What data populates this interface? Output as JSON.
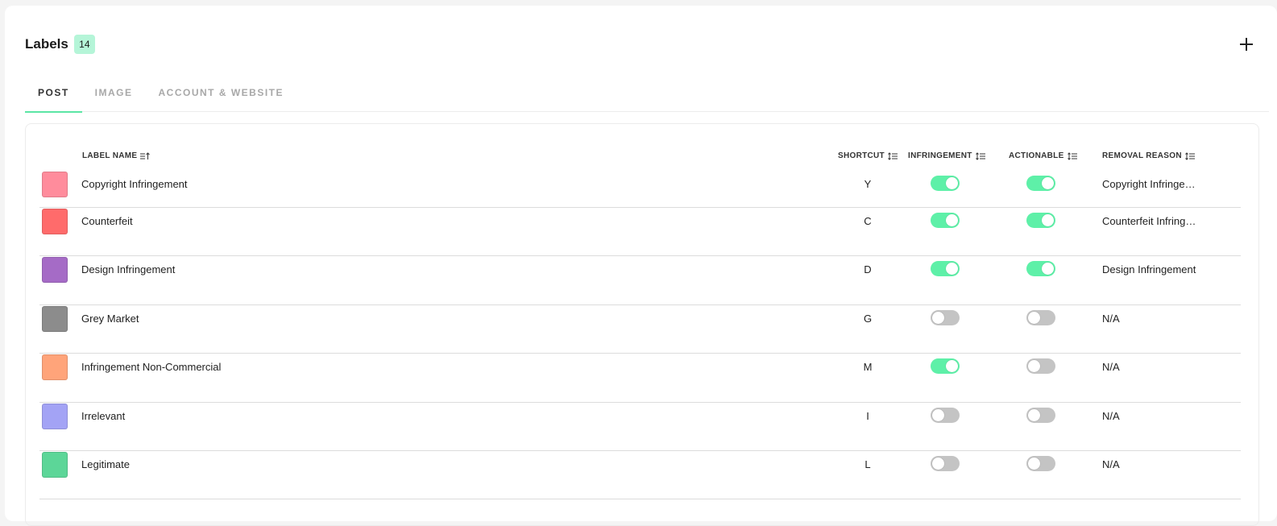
{
  "header": {
    "title": "Labels",
    "count": "14"
  },
  "tabs": [
    {
      "label": "POST",
      "active": true
    },
    {
      "label": "IMAGE",
      "active": false
    },
    {
      "label": "ACCOUNT & WEBSITE",
      "active": false
    }
  ],
  "columns": {
    "label_name": "LABEL NAME",
    "shortcut": "SHORTCUT",
    "infringement": "INFRINGEMENT",
    "actionable": "ACTIONABLE",
    "removal_reason": "REMOVAL REASON"
  },
  "rows": [
    {
      "color": "#ff8c9c",
      "name": "Copyright Infringement",
      "shortcut": "Y",
      "infringement": true,
      "actionable": true,
      "reason": "Copyright Infringement"
    },
    {
      "color": "#ff6b6b",
      "name": "Counterfeit",
      "shortcut": "C",
      "infringement": true,
      "actionable": true,
      "reason": "Counterfeit Infringement"
    },
    {
      "color": "#a56bc6",
      "name": "Design Infringement",
      "shortcut": "D",
      "infringement": true,
      "actionable": true,
      "reason": "Design Infringement"
    },
    {
      "color": "#8c8c8c",
      "name": "Grey Market",
      "shortcut": "G",
      "infringement": false,
      "actionable": false,
      "reason": "N/A"
    },
    {
      "color": "#ffa47a",
      "name": "Infringement Non-Commercial",
      "shortcut": "M",
      "infringement": true,
      "actionable": false,
      "reason": "N/A"
    },
    {
      "color": "#a3a3f5",
      "name": "Irrelevant",
      "shortcut": "I",
      "infringement": false,
      "actionable": false,
      "reason": "N/A"
    },
    {
      "color": "#5cd698",
      "name": "Legitimate",
      "shortcut": "L",
      "infringement": false,
      "actionable": false,
      "reason": "N/A"
    }
  ],
  "colors": {
    "accent": "#5be6a5",
    "toggle_on": "#5ef0a8",
    "toggle_off": "#c4c4c4",
    "badge_bg": "#b5f5d8"
  },
  "icons": {
    "add": "plus-icon",
    "sort_asc": "sort-ascending-icon",
    "sort": "sort-icon"
  }
}
